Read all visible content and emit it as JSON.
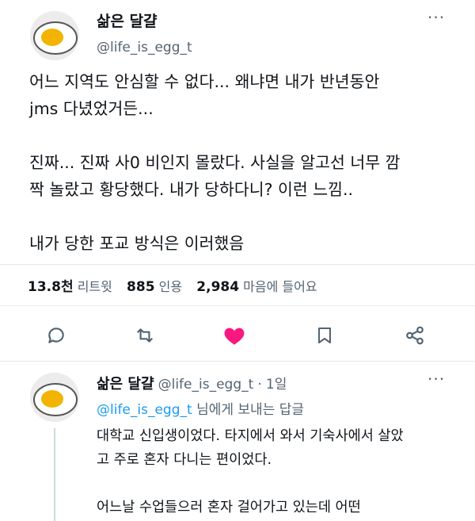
{
  "tweet": {
    "author_name": "삶은 달걀",
    "author_handle": "@life_is_egg_t",
    "more": "···",
    "lines": [
      "어느 지역도 안심할 수 없다... 왜냐면 내가 반년동안",
      "jms 다녔었거든...",
      "",
      "진짜... 진짜 사0 비인지 몰랐다. 사실을 알고선 너무 깜",
      "짝 놀랐고 황당했다. 내가 당하다니? 이런 느낌..",
      "",
      "내가 당한 포교 방식은 이러했음"
    ],
    "stats": {
      "retweets_num": "13.8천",
      "retweets_label": "리트윗",
      "quotes_num": "885",
      "quotes_label": "인용",
      "likes_num": "2,984",
      "likes_label": "마음에 들어요"
    },
    "actions": [
      "comment-icon",
      "retweet-icon",
      "heart-icon",
      "bookmark-icon",
      "share-icon"
    ]
  },
  "reply": {
    "author_name": "삶은 달걀",
    "author_handle": "@life_is_egg_t",
    "sep": "·",
    "time": "1일",
    "more": "···",
    "replying_to_handle": "@life_is_egg_t",
    "replying_to_suffix": "님에게 보내는 답글",
    "lines": [
      "대학교 신입생이었다. 타지에서 와서 기숙사에서 살았",
      "고 주로 혼자 다니는 편이었다.",
      "",
      "어느날 수업들으러 혼자 걸어가고 있는데 어떤"
    ]
  },
  "colors": {
    "like": "#f91880",
    "link": "#1d9bf0",
    "muted": "#536471"
  }
}
